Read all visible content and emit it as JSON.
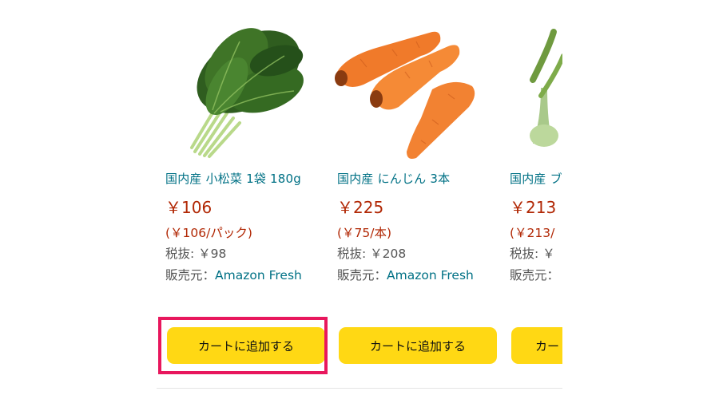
{
  "products": [
    {
      "title": "国内産 小松菜 1袋 180g",
      "price": "￥106",
      "unit_price": "(￥106/パック)",
      "tax_excluded": "税抜: ￥98",
      "seller_label": "販売元：",
      "seller_name": "Amazon Fresh",
      "cart_label": "カートに追加する",
      "image_icon": "komatsuna-icon"
    },
    {
      "title": "国内産 にんじん 3本",
      "price": "￥225",
      "unit_price": "(￥75/本)",
      "tax_excluded": "税抜: ￥208",
      "seller_label": "販売元：",
      "seller_name": "Amazon Fresh",
      "cart_label": "カートに追加する",
      "image_icon": "carrot-icon"
    },
    {
      "title": "国内産 ブ",
      "price": "￥213",
      "unit_price": "(￥213/",
      "tax_excluded": "税抜: ￥",
      "seller_label": "販売元：",
      "seller_name": "",
      "cart_label": "カー",
      "image_icon": "broccoli-icon"
    }
  ],
  "colors": {
    "link": "#007185",
    "price": "#b12704",
    "button": "#ffd814",
    "highlight": "#e8175d"
  }
}
